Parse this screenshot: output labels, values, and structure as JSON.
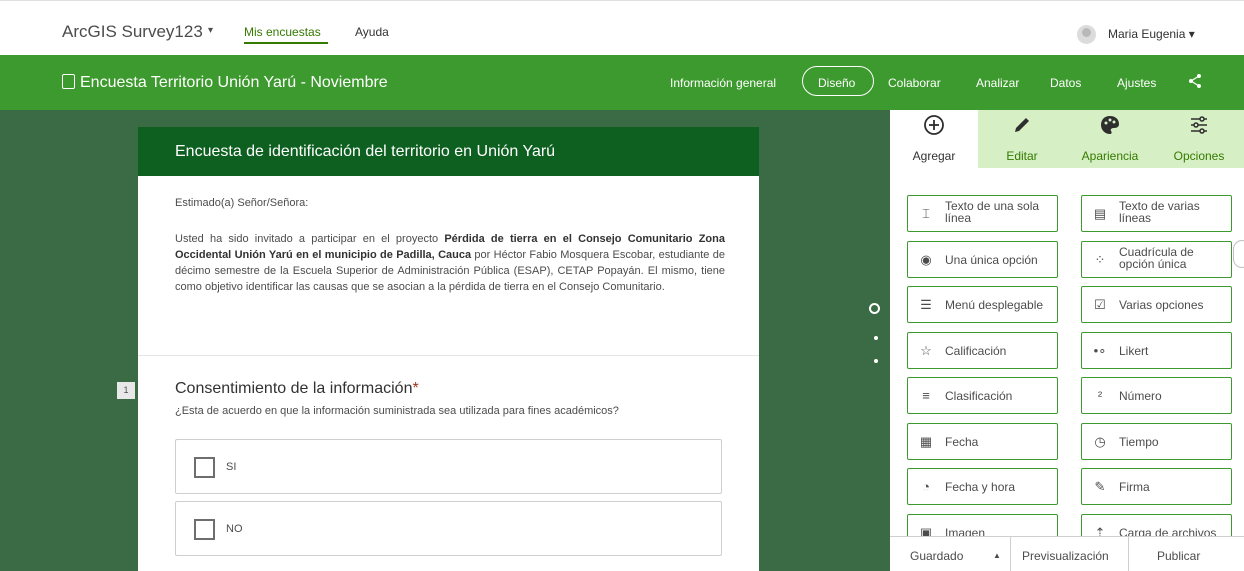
{
  "topbar": {
    "brand": "ArcGIS Survey123",
    "brand_caret": "▾",
    "nav": [
      "Mis encuestas",
      "Ayuda"
    ],
    "user": "Maria Eugenia ▾"
  },
  "survey_header": {
    "title": "Encuesta Territorio Unión Yarú - Noviembre",
    "nav": [
      "Información general",
      "Diseño",
      "Colaborar",
      "Analizar",
      "Datos",
      "Ajustes"
    ],
    "active": "Diseño"
  },
  "form": {
    "title": "Encuesta de identificación del territorio en Unión Yarú",
    "greeting": "Estimado(a) Señor/Señora:",
    "intro_parts": [
      "Usted ha sido invitado a participar en el proyecto ",
      "Pérdida de tierra en el Consejo Comunitario Zona Occidental Unión Yarú en el municipio de Padilla, Cauca",
      " por Héctor Fabio Mosquera Escobar, estudiante de décimo semestre de la Escuela Superior de Administración Pública (ESAP), CETAP Popayán. El mismo, tiene como objetivo identificar las causas que se asocian a la pérdida de tierra en el Consejo Comunitario."
    ],
    "question_number": "1",
    "question_title": "Consentimiento de la información",
    "required_mark": "*",
    "question_desc": "¿Esta de acuerdo en que la información suministrada sea utilizada para fines académicos?",
    "options": [
      "SI",
      "NO"
    ]
  },
  "panel": {
    "tabs": [
      {
        "label": "Agregar",
        "icon": "plus-circle-icon"
      },
      {
        "label": "Editar",
        "icon": "pencil-icon"
      },
      {
        "label": "Apariencia",
        "icon": "palette-icon"
      },
      {
        "label": "Opciones",
        "icon": "sliders-icon"
      }
    ],
    "tiles": [
      {
        "label": "Texto de una sola línea",
        "l1": "Texto de una sola",
        "l2": "línea",
        "icon": "single-line-text-icon"
      },
      {
        "label": "Texto de varias líneas",
        "l1": "Texto de varias",
        "l2": "líneas",
        "icon": "multi-line-text-icon"
      },
      {
        "label": "Una única opción",
        "l1": "Una única opción",
        "l2": "",
        "icon": "radio-icon"
      },
      {
        "label": "Cuadrícula de opción única",
        "l1": "Cuadrícula de",
        "l2": "opción única",
        "icon": "grid-icon"
      },
      {
        "label": "Menú desplegable",
        "l1": "Menú desplegable",
        "l2": "",
        "icon": "dropdown-icon"
      },
      {
        "label": "Varias opciones",
        "l1": "Varias opciones",
        "l2": "",
        "icon": "checkbox-icon"
      },
      {
        "label": "Calificación",
        "l1": "Calificación",
        "l2": "",
        "icon": "star-icon"
      },
      {
        "label": "Likert",
        "l1": "Likert",
        "l2": "",
        "icon": "likert-icon"
      },
      {
        "label": "Clasificación",
        "l1": "Clasificación",
        "l2": "",
        "icon": "ranking-icon"
      },
      {
        "label": "Número",
        "l1": "Número",
        "l2": "",
        "icon": "number-icon"
      },
      {
        "label": "Fecha",
        "l1": "Fecha",
        "l2": "",
        "icon": "calendar-icon"
      },
      {
        "label": "Tiempo",
        "l1": "Tiempo",
        "l2": "",
        "icon": "clock-icon"
      },
      {
        "label": "Fecha y hora",
        "l1": "Fecha y hora",
        "l2": "",
        "icon": "datetime-icon"
      },
      {
        "label": "Firma",
        "l1": "Firma",
        "l2": "",
        "icon": "signature-icon"
      },
      {
        "label": "Imagen",
        "l1": "Imagen",
        "l2": "",
        "icon": "image-icon"
      },
      {
        "label": "Carga de archivos",
        "l1": "Carga de archivos",
        "l2": "",
        "icon": "upload-icon"
      }
    ],
    "bottom": {
      "saved": "Guardado",
      "preview": "Previsualización",
      "publish": "Publicar"
    }
  },
  "colors": {
    "green_header": "#3d9a2e",
    "dark_green": "#0e6021",
    "canvas": "#3b6b45",
    "accent": "#357a00"
  }
}
